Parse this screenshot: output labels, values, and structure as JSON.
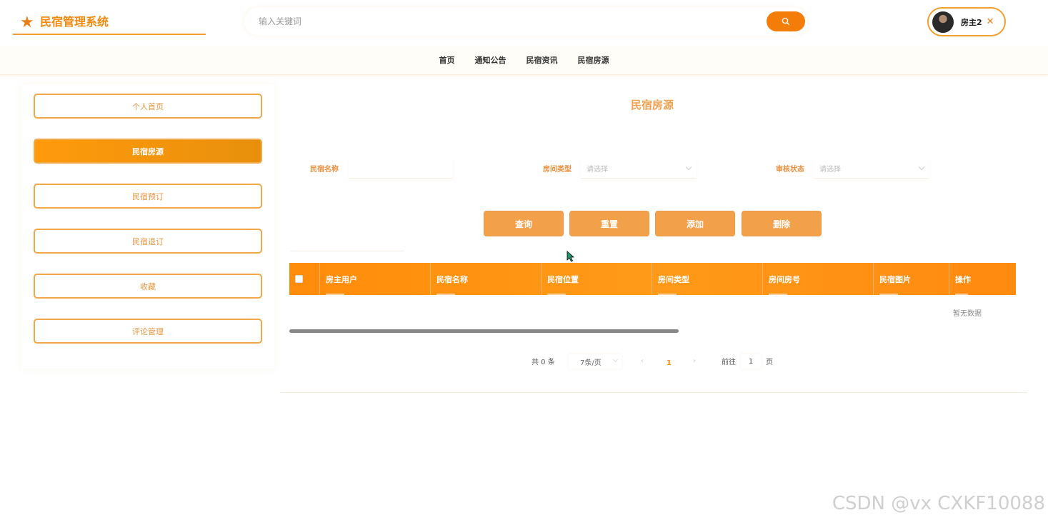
{
  "header": {
    "logo_title": "民宿管理系统",
    "search_placeholder": "输入关键词",
    "user_name": "房主2"
  },
  "nav": {
    "items": [
      "首页",
      "通知公告",
      "民宿资讯",
      "民宿房源"
    ]
  },
  "sidebar": {
    "items": [
      {
        "label": "个人首页",
        "active": false
      },
      {
        "label": "民宿房源",
        "active": true
      },
      {
        "label": "民宿预订",
        "active": false
      },
      {
        "label": "民宿退订",
        "active": false
      },
      {
        "label": "收藏",
        "active": false
      },
      {
        "label": "评论管理",
        "active": false
      }
    ]
  },
  "main": {
    "title": "民宿房源",
    "filters": {
      "name_label": "民宿名称",
      "name_value": "",
      "type_label": "房间类型",
      "type_placeholder": "请选择",
      "status_label": "审核状态",
      "status_placeholder": "请选择"
    },
    "buttons": {
      "query": "查询",
      "reset": "重置",
      "add": "添加",
      "delete": "删除"
    },
    "table": {
      "columns": [
        "房主用户",
        "民宿名称",
        "民宿位置",
        "房间类型",
        "房间房号",
        "民宿图片",
        "操作"
      ],
      "empty_text": "暂无数据"
    },
    "pagination": {
      "total_text": "共 0 条",
      "page_size": "7条/页",
      "current_page": "1",
      "goto_label": "前往",
      "goto_value": "1",
      "page_unit": "页"
    }
  },
  "watermark": "CSDN @vx  CXKF10088",
  "colors": {
    "accent": "#f47d0a",
    "border": "#f0a84a",
    "title": "#f0a050"
  }
}
